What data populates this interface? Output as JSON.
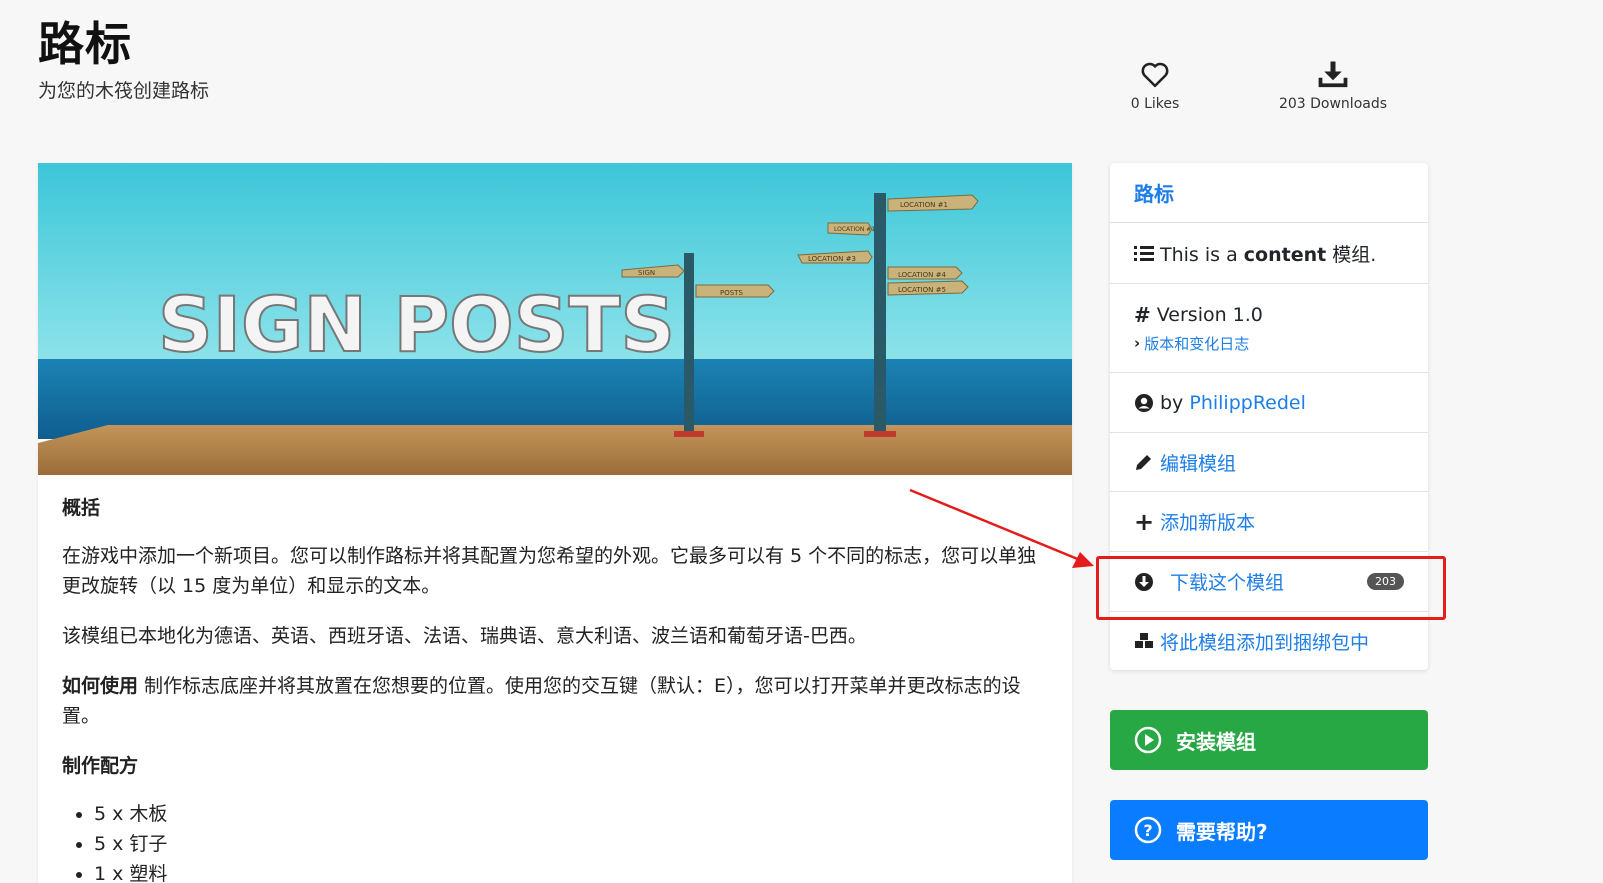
{
  "header": {
    "title": "路标",
    "subtitle": "为您的木筏创建路标"
  },
  "stats": {
    "likes": "0 Likes",
    "downloads": "203 Downloads"
  },
  "banner": {
    "logo_text": "SIGN POSTS",
    "sign_labels": [
      "SIGN",
      "POSTS",
      "LOCATION #1",
      "LOCATION #2",
      "LOCATION #3",
      "LOCATION #4",
      "LOCATION #5"
    ]
  },
  "description": {
    "overview_heading": "概括",
    "overview_text": "在游戏中添加一个新项目。您可以制作路标并将其配置为您希望的外观。它最多可以有 5 个不同的标志，您可以单独更改旋转（以 15 度为单位）和显示的文本。",
    "localization_text": "该模组已本地化为德语、英语、西班牙语、法语、瑞典语、意大利语、波兰语和葡萄牙语-巴西。",
    "howto_label": "如何使用",
    "howto_text": " 制作标志底座并将其放置在您想要的位置。使用您的交互键（默认：E），您可以打开菜单并更改标志的设置。",
    "recipe_heading": "制作配方",
    "recipe_items": [
      "5 x 木板",
      "5 x 钉子",
      "1 x 塑料"
    ]
  },
  "sidebar": {
    "title": "路标",
    "type_prefix": "This is a ",
    "type_bold": "content",
    "type_suffix": " 模组.",
    "version": "Version 1.0",
    "changelog_link": "版本和变化日志",
    "author_prefix": "by ",
    "author_name": "PhilippRedel",
    "edit_mod": "编辑模组",
    "add_version": "添加新版本",
    "download_mod": "下载这个模组",
    "download_count": "203",
    "add_to_bundle": "将此模组添加到捆绑包中"
  },
  "buttons": {
    "install": "安装模组",
    "help": "需要帮助?"
  },
  "colors": {
    "link": "#1e7ee8",
    "install_green": "#28a745",
    "help_blue": "#0a7cff",
    "highlight_red": "#e41c1c"
  }
}
